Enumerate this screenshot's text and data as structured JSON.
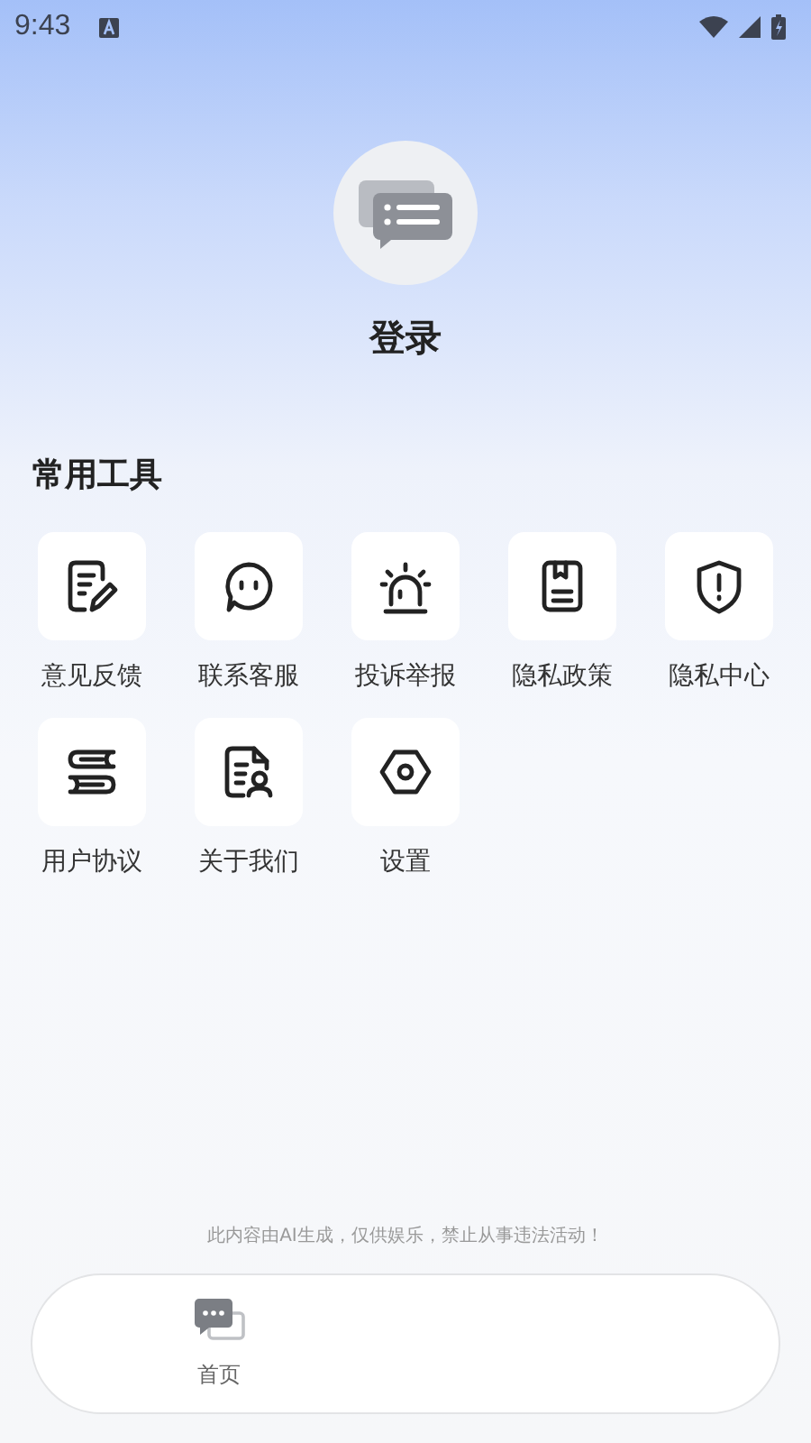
{
  "status_bar": {
    "time": "9:43"
  },
  "profile": {
    "login_label": "登录"
  },
  "tools": {
    "title": "常用工具",
    "items": [
      {
        "label": "意见反馈"
      },
      {
        "label": "联系客服"
      },
      {
        "label": "投诉举报"
      },
      {
        "label": "隐私政策"
      },
      {
        "label": "隐私中心"
      },
      {
        "label": "用户协议"
      },
      {
        "label": "关于我们"
      },
      {
        "label": "设置"
      }
    ]
  },
  "disclaimer": "此内容由AI生成，仅供娱乐，禁止从事违法活动！",
  "bottom_nav": [
    {
      "label": "首页"
    }
  ]
}
